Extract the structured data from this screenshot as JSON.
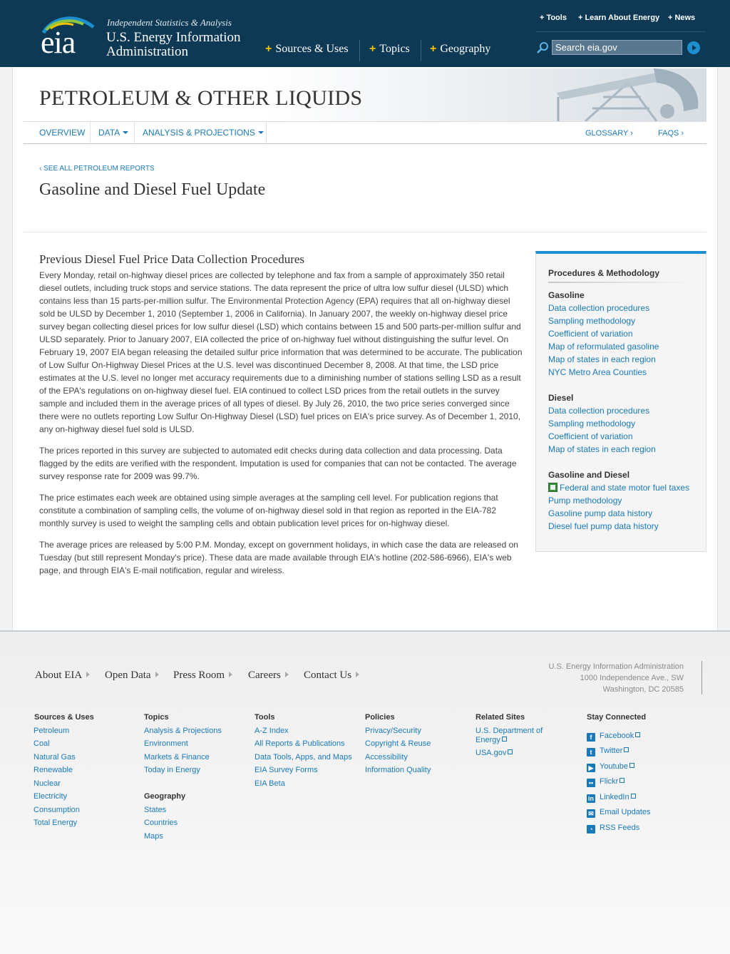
{
  "header": {
    "logo_text": "eia",
    "tagline": "Independent Statistics & Analysis",
    "org_line1": "U.S. Energy Information",
    "org_line2": "Administration",
    "main_nav": [
      "Sources & Uses",
      "Topics",
      "Geography"
    ],
    "utility_nav": [
      "Tools",
      "Learn About Energy",
      "News"
    ],
    "search_placeholder": "Search eia.gov"
  },
  "banner": {
    "title": "PETROLEUM & OTHER LIQUIDS"
  },
  "subnav": {
    "left": [
      "OVERVIEW",
      "DATA",
      "ANALYSIS & PROJECTIONS"
    ],
    "right": [
      "GLOSSARY ›",
      "FAQS ›"
    ]
  },
  "back_link": "‹ SEE ALL PETROLEUM REPORTS",
  "page_title": "Gasoline and Diesel Fuel Update",
  "content": {
    "section_title": "Previous Diesel Fuel Price Data Collection Procedures",
    "paragraphs": [
      "Every Monday, retail on-highway diesel prices are collected by telephone and fax from a sample of approximately 350 retail diesel outlets, including truck stops and service stations. The data represent the price of ultra low sulfur diesel (ULSD) which contains less than 15 parts-per-million sulfur. The Environmental Protection Agency (EPA) requires that all on-highway diesel sold be ULSD by December 1, 2010 (September 1, 2006 in California). In January 2007, the weekly on-highway diesel price survey began collecting diesel prices for low sulfur diesel (LSD) which contains between 15 and 500 parts-per-million sulfur and ULSD separately. Prior to January 2007, EIA collected the price of on-highway fuel without distinguishing the sulfur level. On February 19, 2007 EIA began releasing the detailed sulfur price information that was determined to be accurate. The publication of Low Sulfur On-Highway Diesel Prices at the U.S. level was discontinued December 8, 2008. At that time, the LSD price estimates at the U.S. level no longer met accuracy requirements due to a diminishing number of stations selling LSD as a result of the EPA's regulations on on-highway diesel fuel. EIA continued to collect LSD prices from the retail outlets in the survey sample and included them in the average prices of all types of diesel. By July 26, 2010, the two price series converged since there were no outlets reporting Low Sulfur On-Highway Diesel (LSD) fuel prices on EIA's price survey. As of December 1, 2010, any on-highway diesel fuel sold is ULSD.",
      "The prices reported in this survey are subjected to automated edit checks during data collection and data processing. Data flagged by the edits are verified with the respondent. Imputation is used for companies that can not be contacted. The average survey response rate for 2009 was 99.7%.",
      "The price estimates each week are obtained using simple averages at the sampling cell level. For publication regions that constitute a combination of sampling cells, the volume of on-highway diesel sold in that region as reported in the EIA-782 monthly survey is used to weight the sampling cells and obtain publication level prices for on-highway diesel.",
      "The average prices are released by 5:00 P.M. Monday, except on government holidays, in which case the data are released on Tuesday (but still represent Monday's price). These data are made available through EIA's hotline (202-586-6966), EIA's web page, and through EIA's E-mail notification, regular and wireless."
    ]
  },
  "sidebar": {
    "title": "Procedures & Methodology",
    "groups": [
      {
        "heading": "Gasoline",
        "links": [
          "Data collection procedures",
          "Sampling methodology",
          "Coefficient of variation",
          "Map of reformulated gasoline",
          "Map of states in each region",
          "NYC Metro Area Counties"
        ]
      },
      {
        "heading": "Diesel",
        "links": [
          "Data collection procedures",
          "Sampling methodology",
          "Coefficient of variation",
          "Map of states in each region"
        ]
      },
      {
        "heading": "Gasoline and Diesel",
        "links": [
          "Federal and state motor fuel taxes",
          "Pump methodology",
          "Gasoline pump data history",
          "Diesel fuel pump data history"
        ]
      }
    ]
  },
  "footer": {
    "nav": [
      "About EIA",
      "Open Data",
      "Press Room",
      "Careers",
      "Contact Us"
    ],
    "address": [
      "U.S. Energy Information Administration",
      "1000 Independence Ave., SW",
      "Washington, DC 20585"
    ],
    "columns": [
      {
        "heading": "Sources & Uses",
        "links": [
          "Petroleum",
          "Coal",
          "Natural Gas",
          "Renewable",
          "Nuclear",
          "Electricity",
          "Consumption",
          "Total Energy"
        ]
      },
      {
        "heading": "Topics",
        "links": [
          "Analysis & Projections",
          "Environment",
          "Markets & Finance",
          "Today in Energy"
        ]
      },
      {
        "heading": "Geography",
        "links": [
          "States",
          "Countries",
          "Maps"
        ]
      },
      {
        "heading": "Tools",
        "links": [
          "A-Z Index",
          "All Reports & Publications",
          "Data Tools, Apps, and Maps",
          "EIA Survey Forms",
          "EIA Beta"
        ]
      },
      {
        "heading": "Policies",
        "links": [
          "Privacy/Security",
          "Copyright & Reuse",
          "Accessibility",
          "Information Quality"
        ]
      },
      {
        "heading": "Related Sites",
        "links": [
          "U.S. Department of",
          "Energy",
          "USA.gov"
        ]
      },
      {
        "heading": "Stay Connected",
        "links": [
          "Facebook",
          "Twitter",
          "Youtube",
          "Flickr",
          "LinkedIn",
          "Email Updates",
          "RSS Feeds"
        ]
      }
    ]
  },
  "colors": {
    "header_bg": "#0d3955",
    "link": "#1a79b9",
    "accent": "#1d8fce",
    "plus": "#f2c200"
  }
}
